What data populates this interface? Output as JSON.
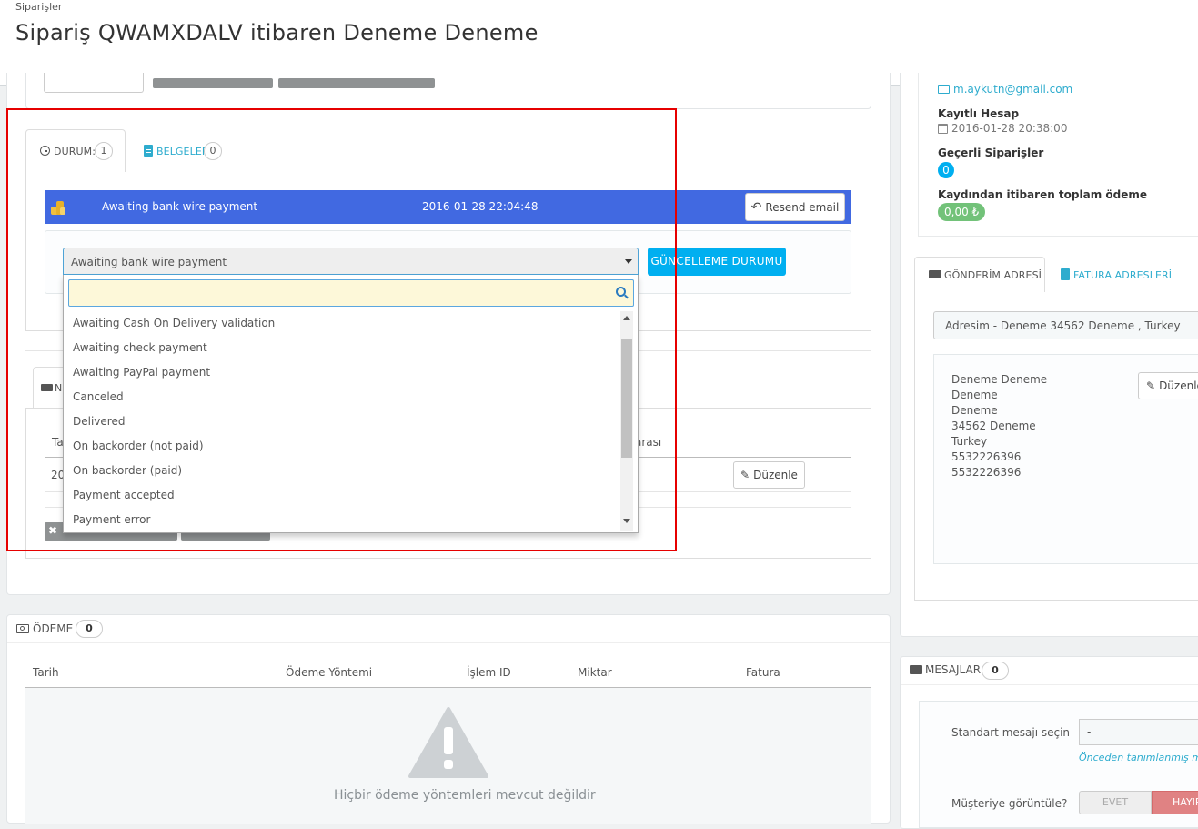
{
  "header": {
    "breadcrumb": "Siparişler",
    "title": "Sipariş QWAMXDALV itibaren Deneme Deneme"
  },
  "status_panel": {
    "tab_status_label": "DURUM:",
    "tab_status_count": "1",
    "tab_documents_label": "BELGELER",
    "tab_documents_count": "0",
    "history_row": {
      "status": "Awaiting bank wire payment",
      "date": "2016-01-28 22:04:48",
      "resend_label": "Resend email"
    },
    "select_value": "Awaiting bank wire payment",
    "update_button": "GÜNCELLEME DURUMU",
    "dropdown_options": [
      "Awaiting Cash On Delivery validation",
      "Awaiting check payment",
      "Awaiting PayPal payment",
      "Canceled",
      "Delivered",
      "On backorder (not paid)",
      "On backorder (paid)",
      "Payment accepted",
      "Payment error"
    ],
    "search_placeholder": ""
  },
  "shipping_panel": {
    "tab_fragment": "N",
    "col_fragment_left": "Ta",
    "col_fragment_right": "arası",
    "row_fragment": "20",
    "edit_label": "Düzenle"
  },
  "customer": {
    "email": "m.aykutn@gmail.com",
    "registered_label": "Kayıtlı Hesap",
    "registered_date": "2016-01-28 20:38:00",
    "valid_orders_label": "Geçerli Siparişler",
    "valid_orders_count": "0",
    "total_paid_label": "Kaydından itibaren toplam ödeme",
    "total_paid_value": "0,00 ₺"
  },
  "address_panel": {
    "tab_shipping": "GÖNDERİM ADRESİ",
    "tab_invoice": "FATURA ADRESLERİ",
    "selected_address": "Adresim - Deneme 34562 Deneme , Turkey",
    "edit_label": "Düzenle",
    "lines": [
      "Deneme Deneme",
      "Deneme",
      "Deneme",
      "34562 Deneme",
      "Turkey",
      "5532226396",
      "5532226396"
    ]
  },
  "payment_panel": {
    "title": "ÖDEME",
    "count": "0",
    "columns": [
      "Tarih",
      "Ödeme Yöntemi",
      "İşlem ID",
      "Miktar",
      "Fatura"
    ],
    "empty_text": "Hiçbir ödeme yöntemleri mevcut değildir"
  },
  "messages_panel": {
    "title": "MESAJLAR",
    "count": "0",
    "standard_label": "Standart mesajı seçin",
    "standard_value": "-",
    "predefined_link": "Önceden tanımlanmış m",
    "visible_label": "Müşteriye görüntüle?",
    "yes_label": "EVET",
    "no_label": "HAYIR"
  },
  "colors": {
    "accent": "#2eacce",
    "status_bar": "#4169e1",
    "highlight": "#e60000",
    "success": "#72c279"
  }
}
